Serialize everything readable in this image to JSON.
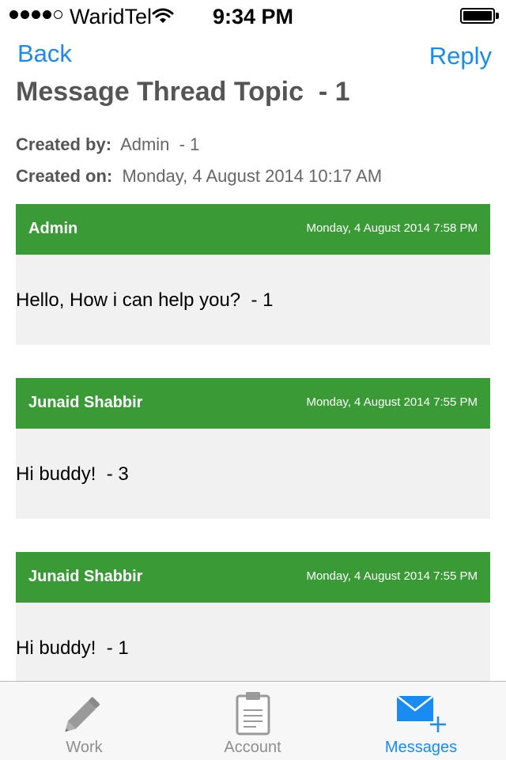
{
  "status_bar": {
    "carrier": "WaridTel",
    "time": "9:34 PM",
    "signal_bars": 4,
    "signal_max": 5,
    "icons": [
      "wifi-icon",
      "battery-icon"
    ]
  },
  "nav": {
    "back_label": "Back",
    "reply_label": "Reply"
  },
  "thread": {
    "title": "Message Thread Topic  - 1",
    "created_by_label": "Created by:",
    "created_by_value": "Admin  - 1",
    "created_on_label": "Created on:",
    "created_on_value": "Monday, 4 August 2014 10:17 AM"
  },
  "messages": [
    {
      "author": "Admin",
      "date": "Monday, 4 August 2014 7:58 PM",
      "text": "Hello, How i can help you?  - 1"
    },
    {
      "author": "Junaid Shabbir",
      "date": "Monday, 4 August 2014 7:55 PM",
      "text": "Hi buddy!  - 3"
    },
    {
      "author": "Junaid Shabbir",
      "date": "Monday, 4 August 2014 7:55 PM",
      "text": "Hi buddy!  - 1"
    }
  ],
  "tabs": [
    {
      "label": "Work",
      "icon": "pencil-icon",
      "active": false
    },
    {
      "label": "Account",
      "icon": "clipboard-icon",
      "active": false
    },
    {
      "label": "Messages",
      "icon": "envelope-plus-icon",
      "active": true
    }
  ],
  "colors": {
    "accent": "#1a8bf0",
    "message_header": "#3a9a36",
    "message_body": "#f1f1f1",
    "inactive_tab": "#8e8e8e"
  }
}
